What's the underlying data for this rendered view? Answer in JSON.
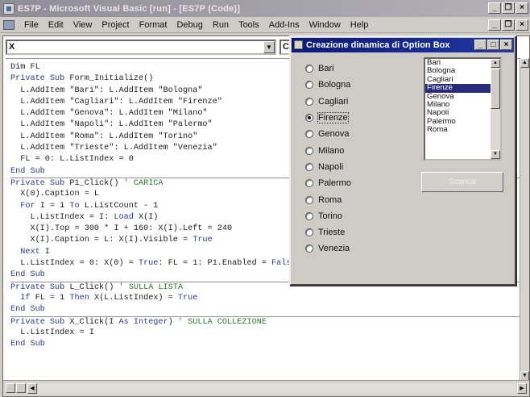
{
  "window": {
    "title": "ES7P - Microsoft Visual Basic [run] - [ES7P (Code)]",
    "controls": [
      "_",
      "×"
    ]
  },
  "menubar": {
    "items": [
      "File",
      "Edit",
      "View",
      "Project",
      "Format",
      "Debug",
      "Run",
      "Tools",
      "Add-Ins",
      "Window",
      "Help"
    ]
  },
  "code_window": {
    "object_combo": "X",
    "procedure_combo": "C",
    "lines": [
      [
        [
          "tx",
          "Dim FL"
        ]
      ],
      [
        [
          "kw",
          "Private Sub "
        ],
        [
          "tx",
          "Form_Initialize()"
        ]
      ],
      [
        [
          "tx",
          "  L.AddItem \"Bari\": L.AddItem \"Bologna\""
        ]
      ],
      [
        [
          "tx",
          "  L.AddItem \"Cagliari\": L.AddItem \"Firenze\""
        ]
      ],
      [
        [
          "tx",
          "  L.AddItem \"Genova\": L.AddItem \"Milano\""
        ]
      ],
      [
        [
          "tx",
          "  L.AddItem \"Napoli\": L.AddItem \"Palermo\""
        ]
      ],
      [
        [
          "tx",
          "  L.AddItem \"Roma\": L.AddItem \"Torino\""
        ]
      ],
      [
        [
          "tx",
          "  L.AddItem \"Trieste\": L.AddItem \"Venezia\""
        ]
      ],
      [
        [
          "tx",
          "  FL = 0: L.ListIndex = 0"
        ]
      ],
      [
        [
          "kw",
          "End Sub"
        ]
      ],
      [
        [
          "kw",
          "Private Sub "
        ],
        [
          "tx",
          "P1_Click() "
        ],
        [
          "cm",
          "' CARICA"
        ]
      ],
      [
        [
          "tx",
          "  X(0).Caption = L"
        ]
      ],
      [
        [
          "kw",
          "  For "
        ],
        [
          "tx",
          "I = 1 "
        ],
        [
          "kw",
          "To "
        ],
        [
          "tx",
          "L.ListCount - 1"
        ]
      ],
      [
        [
          "tx",
          "    L.ListIndex = I: "
        ],
        [
          "kw",
          "Load "
        ],
        [
          "tx",
          "X(I)"
        ]
      ],
      [
        [
          "tx",
          "    X(I).Top = 300 * I + 160: X(I).Left = 240"
        ]
      ],
      [
        [
          "tx",
          "    X(I).Caption = L: X(I).Visible = "
        ],
        [
          "kw",
          "True"
        ]
      ],
      [
        [
          "kw",
          "  Next "
        ],
        [
          "tx",
          "I"
        ]
      ],
      [
        [
          "tx",
          "  L.ListIndex = 0: X(0) = "
        ],
        [
          "kw",
          "True"
        ],
        [
          "tx",
          ": FL = 1: P1.Enabled = "
        ],
        [
          "kw",
          "False"
        ]
      ],
      [
        [
          "kw",
          "End Sub"
        ]
      ],
      [
        [
          "kw",
          "Private Sub "
        ],
        [
          "tx",
          "L_Click() "
        ],
        [
          "cm",
          "' SULLA LISTA"
        ]
      ],
      [
        [
          "kw",
          "  If "
        ],
        [
          "tx",
          "FL = 1 "
        ],
        [
          "kw",
          "Then "
        ],
        [
          "tx",
          "X(L.ListIndex) = "
        ],
        [
          "kw",
          "True"
        ]
      ],
      [
        [
          "kw",
          "End Sub"
        ]
      ],
      [
        [
          "kw",
          "Private Sub "
        ],
        [
          "tx",
          "X_Click(I "
        ],
        [
          "kw",
          "As Integer"
        ],
        [
          "tx",
          ") "
        ],
        [
          "cm",
          "' SULLA COLLEZIONE"
        ]
      ],
      [
        [
          "tx",
          "  L.ListIndex = I"
        ]
      ],
      [
        [
          "kw",
          "End Sub"
        ]
      ]
    ],
    "separator_before_lines": [
      10,
      19,
      22
    ]
  },
  "form": {
    "title": "Creazione dinamica di Option Box",
    "options": [
      "Bari",
      "Bologna",
      "Cagliari",
      "Firenze",
      "Genova",
      "Milano",
      "Napoli",
      "Palermo",
      "Roma",
      "Torino",
      "Trieste",
      "Venezia"
    ],
    "selected_option": "Firenze",
    "list_items": [
      "Bari",
      "Bologna",
      "Cagliari",
      "Firenze",
      "Genova",
      "Milano",
      "Napoli",
      "Palermo",
      "Roma"
    ],
    "selected_list_item": "Firenze",
    "button_label": "Scarica",
    "button_enabled": false
  },
  "colors": {
    "keyword": "#2b3a9c",
    "comment": "#2a7a2a",
    "form_title_bar": "#0a1a78",
    "list_selection": "#2a2a7a"
  }
}
